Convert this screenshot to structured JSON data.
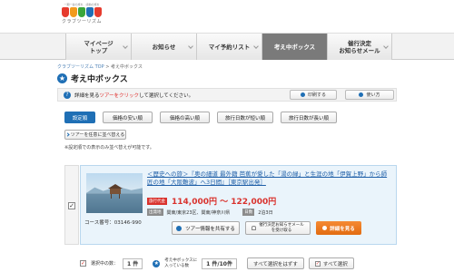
{
  "header": {
    "logo_tagline": "一期一会の旅を、感動の旅を",
    "logo_text": "クラブツーリズム",
    "logo_colors": [
      "#e63b2e",
      "#f29b1d",
      "#3aa63a",
      "#1f6fb5",
      "#e63b2e"
    ]
  },
  "nav": {
    "items": [
      {
        "label": "マイページ\nトップ"
      },
      {
        "label": "お知らせ"
      },
      {
        "label": "マイ予約リスト"
      },
      {
        "label": "考え中ボックス"
      },
      {
        "label": "催行決定\nお知らせメール"
      }
    ],
    "active_index": 3
  },
  "breadcrumb": {
    "home": "クラブツーリズム TOP",
    "separator": " > ",
    "current": "考え中ボックス"
  },
  "page": {
    "title": "考え中ボックス",
    "info_prefix": "詳細を見る",
    "info_link": "ツアーをクリック",
    "info_suffix": "して選択してください。",
    "print_label": "印刷する",
    "help_label": "使い方"
  },
  "sort": {
    "buttons": [
      "設定順",
      "価格の安い順",
      "価格の高い順",
      "旅行日数が短い順",
      "旅行日数が長い順"
    ],
    "active_index": 0,
    "reorder_label": "ツアーを任意に並べ替える",
    "note": "※設定順での表示のみ並べ替えが可能です。"
  },
  "tour": {
    "title": "＜歴史への旅＞『奥の細道 最外籍 芭蕉が愛した「湯の緑」と生涯の地「伊賀上野」から師匠の地「大阪難波」へ3日間』［東京駅出発］",
    "price_tag": "旅行代金",
    "price": "114,000円 ～ 122,000円",
    "dep_tag": "出発地",
    "departure": "関東/東京23区、関東/神奈川県",
    "days_tag": "日数",
    "days": "2泊3日",
    "course_no": "コース番号：03146-990",
    "share_label": "ツアー情報を共有する",
    "mail_label": "催行決定お知らせメールを受け取る",
    "detail_label": "詳細を見る",
    "checked": true
  },
  "footer": {
    "selected_label": "選択中の数：",
    "selected_count": "1 件",
    "box_label": "考え中ボックスに\n入っている数",
    "box_count": "1 件/10件",
    "clear_label": "すべて選択をはずす",
    "select_all_label": "すべて選択",
    "check_mark": "✓"
  }
}
